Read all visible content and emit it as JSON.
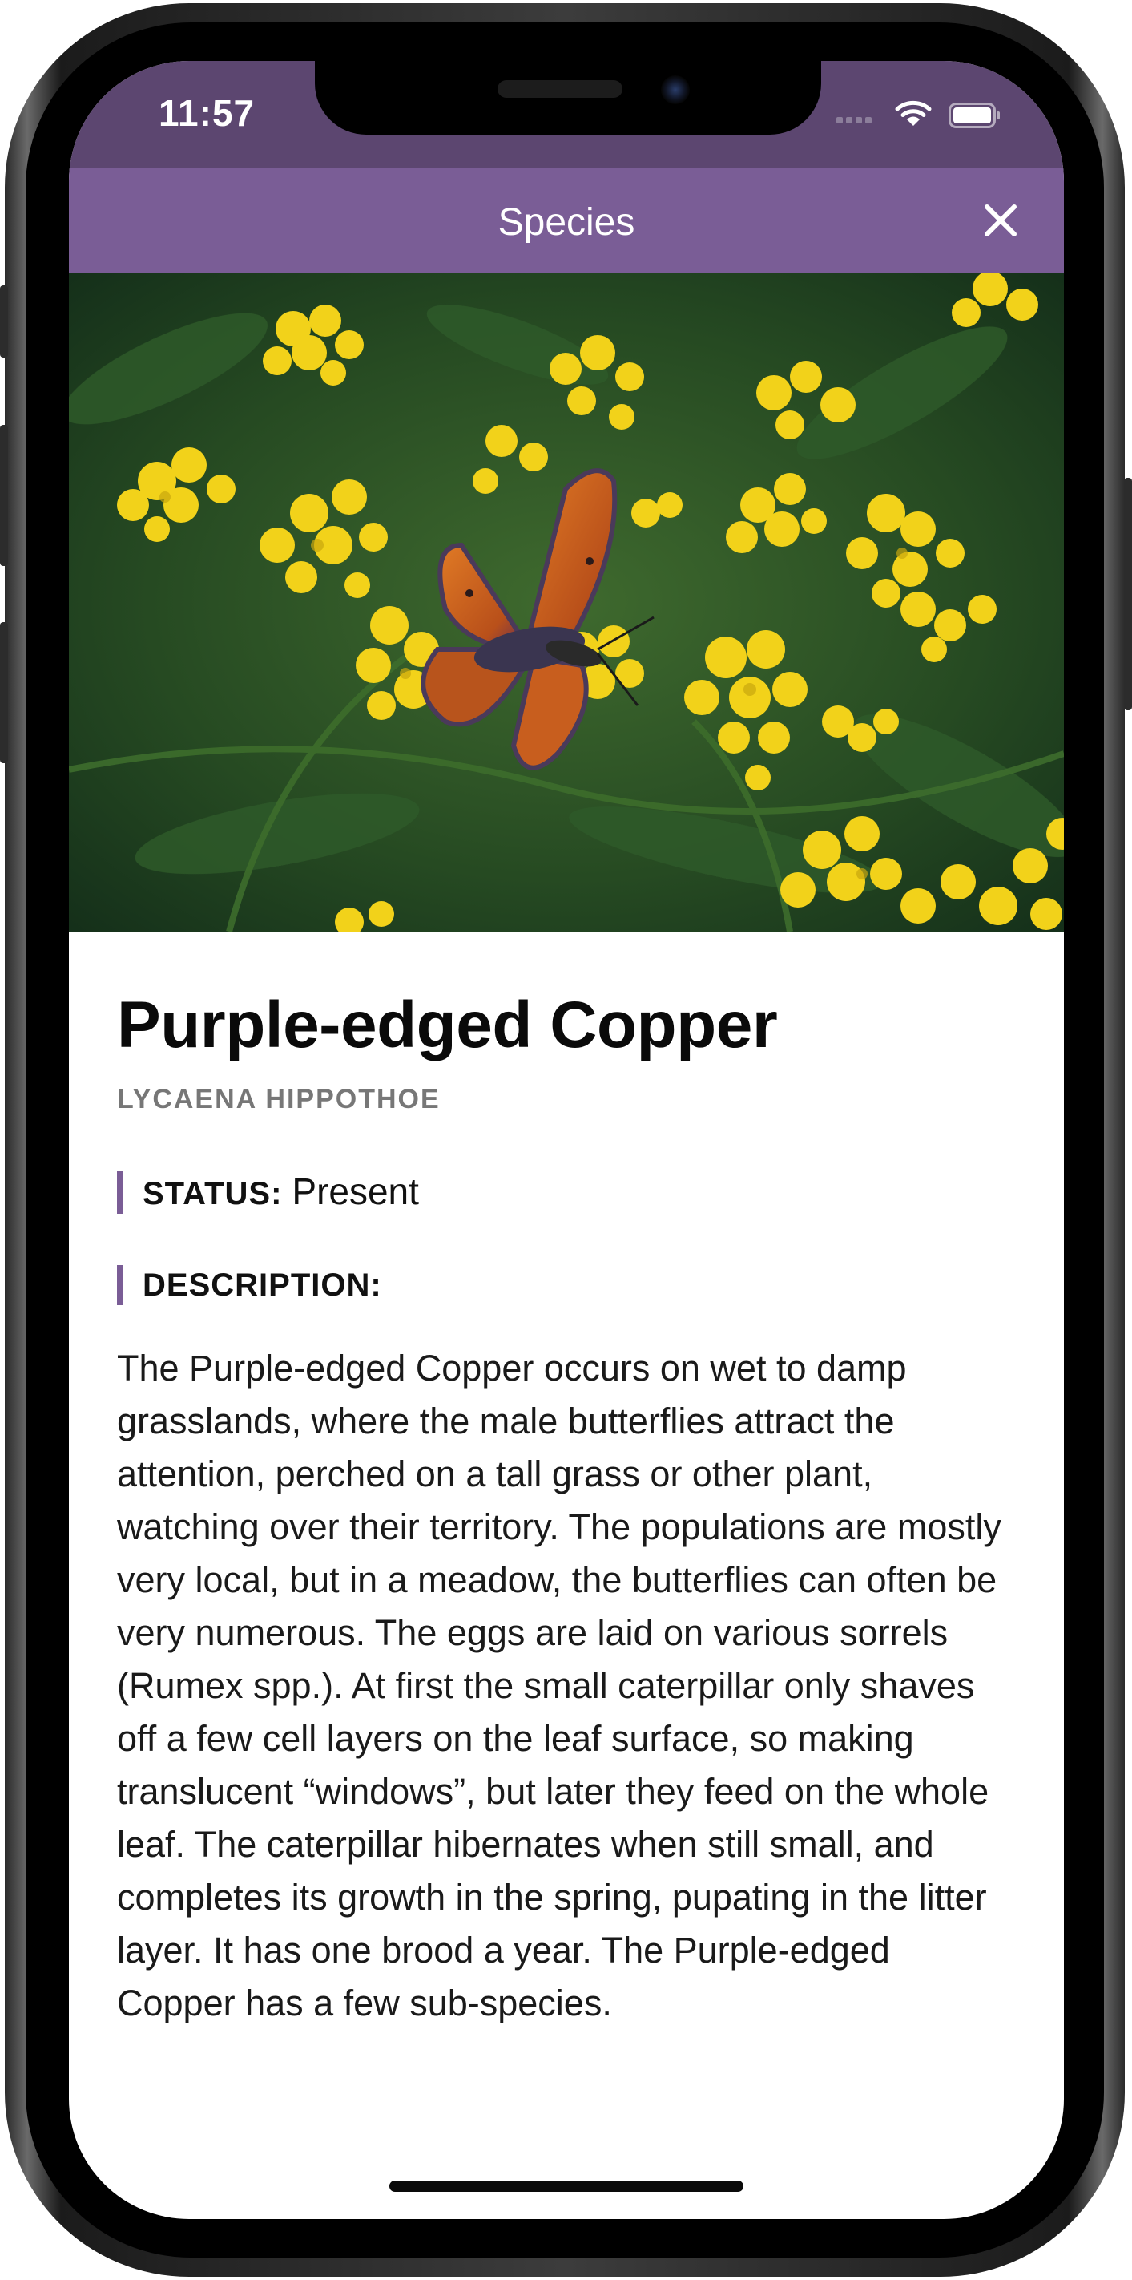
{
  "status_bar": {
    "time": "11:57"
  },
  "nav": {
    "title": "Species"
  },
  "hero": {
    "subject": "Purple-edged Copper butterfly on yellow flowers"
  },
  "species": {
    "common_name": "Purple-edged Copper",
    "scientific_name": "LYCAENA HIPPOTHOE",
    "status_label": "STATUS:",
    "status_value": "Present",
    "description_label": "DESCRIPTION:",
    "description": "The Purple-edged Copper occurs on wet to damp grasslands, where the male butterflies attract the attention, perched on a tall grass or other plant, watching over their territory. The populations are mostly very local, but in a meadow, the butterflies can often be very numerous. The eggs are laid on various sorrels (Rumex spp.). At first the small caterpillar only shaves off a few cell layers on the leaf surface, so making translucent “windows”, but later they feed on the whole leaf. The caterpillar hibernates when still small, and completes its growth in the spring, pupating in the litter layer. It has one brood a year. The Purple-edged Copper has a few sub-species."
  },
  "colors": {
    "status_bar": "#5c4670",
    "nav_bar": "#7a5d96",
    "accent": "#7a5d96"
  },
  "icons": [
    "wifi-icon",
    "battery-icon",
    "close-icon"
  ]
}
